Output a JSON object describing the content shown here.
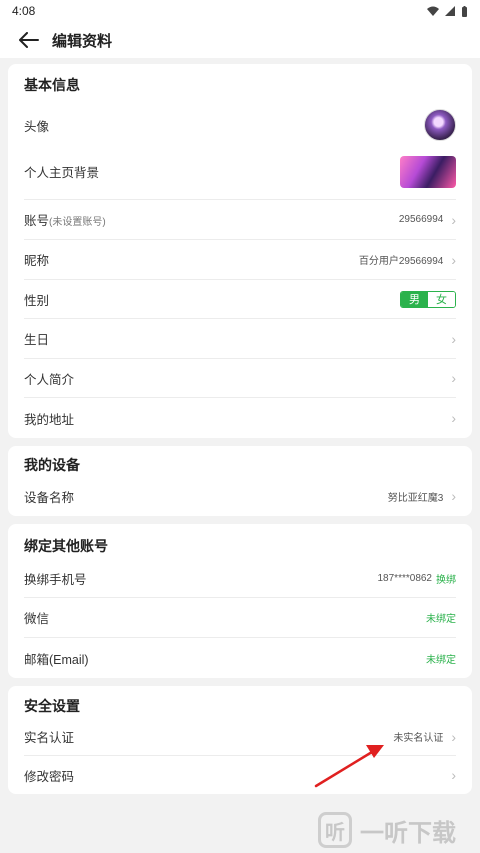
{
  "status_bar": {
    "time": "4:08"
  },
  "app_bar": {
    "title": "编辑资料"
  },
  "basic_info": {
    "title": "基本信息",
    "avatar_label": "头像",
    "background_label": "个人主页背景",
    "account_label": "账号",
    "account_hint": "(未设置账号)",
    "account_value": "29566994",
    "nickname_label": "昵称",
    "nickname_value": "百分用户29566994",
    "gender_label": "性别",
    "gender_male": "男",
    "gender_female": "女",
    "birthday_label": "生日",
    "bio_label": "个人简介",
    "address_label": "我的地址"
  },
  "my_device": {
    "title": "我的设备",
    "device_name_label": "设备名称",
    "device_name_value": "努比亚红魔3"
  },
  "bind_accounts": {
    "title": "绑定其他账号",
    "phone_label": "换绑手机号",
    "phone_value": "187****0862",
    "phone_action": "换绑",
    "wechat_label": "微信",
    "wechat_status": "未绑定",
    "email_label": "邮箱(Email)",
    "email_status": "未绑定"
  },
  "security": {
    "title": "安全设置",
    "realname_label": "实名认证",
    "realname_status": "未实名认证",
    "password_label": "修改密码"
  },
  "watermark": {
    "logo_char": "听",
    "text": "一听下载"
  },
  "colors": {
    "accent_green": "#2bb24c",
    "annotation_red": "#e02020"
  }
}
